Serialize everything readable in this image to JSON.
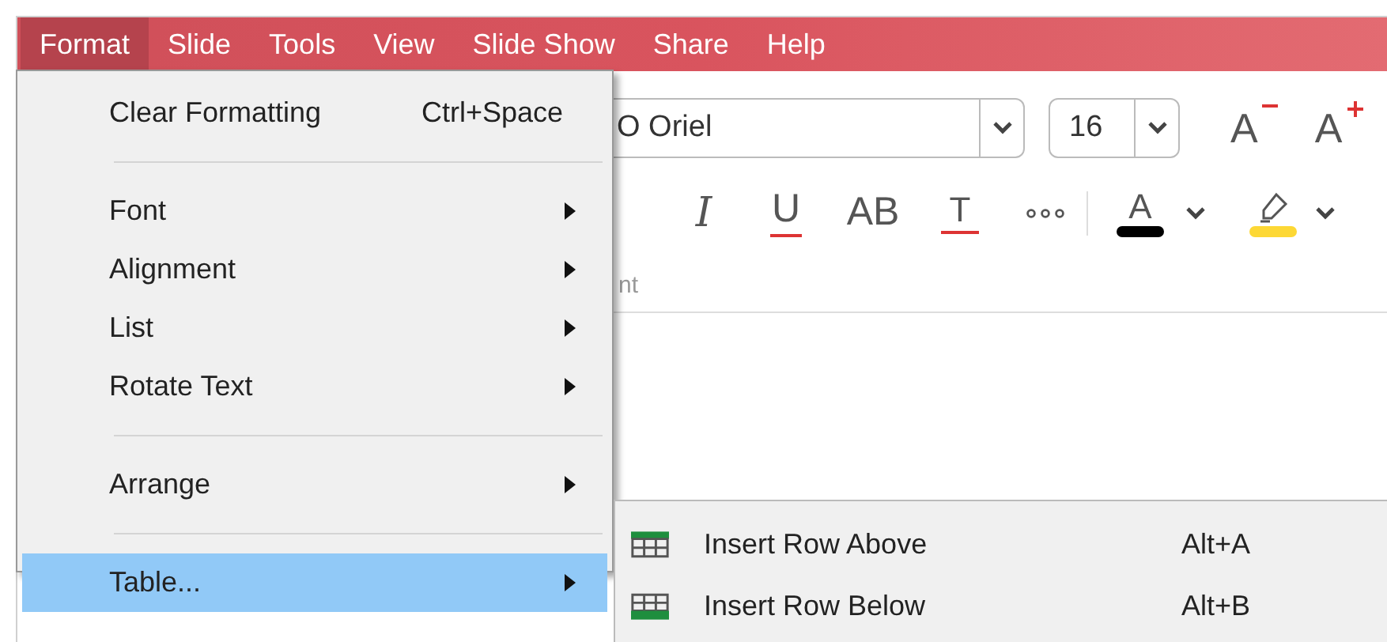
{
  "menubar": [
    {
      "label": "Format",
      "selected": true
    },
    {
      "label": "Slide",
      "selected": false
    },
    {
      "label": "Tools",
      "selected": false
    },
    {
      "label": "View",
      "selected": false
    },
    {
      "label": "Slide Show",
      "selected": false
    },
    {
      "label": "Share",
      "selected": false
    },
    {
      "label": "Help",
      "selected": false
    }
  ],
  "toolbar": {
    "font_field": {
      "value": "O Oriel"
    },
    "size_field": {
      "value": "16"
    },
    "size_buttons": [
      {
        "kind": "shrink",
        "glyph": "A"
      },
      {
        "kind": "grow",
        "glyph": "A"
      }
    ],
    "format_buttons": [
      {
        "kind": "italic",
        "glyph": "I"
      },
      {
        "kind": "underline",
        "glyph": "U"
      },
      {
        "kind": "caps",
        "glyph": "AB"
      },
      {
        "kind": "strike",
        "glyph": "T"
      },
      {
        "kind": "more"
      },
      {
        "kind": "divider"
      },
      {
        "kind": "font_color",
        "glyph": "A",
        "color": "#000000"
      },
      {
        "kind": "dropdown"
      },
      {
        "kind": "highlight",
        "color": "#fdd835"
      },
      {
        "kind": "dropdown"
      }
    ],
    "group_label": "nt"
  },
  "format_menu": [
    {
      "kind": "item",
      "label": "Clear Formatting",
      "shortcut": "Ctrl+Space",
      "selected": false
    },
    {
      "kind": "separator"
    },
    {
      "kind": "submenu",
      "label": "Font",
      "selected": false
    },
    {
      "kind": "submenu",
      "label": "Alignment",
      "selected": false
    },
    {
      "kind": "submenu",
      "label": "List",
      "selected": false
    },
    {
      "kind": "submenu",
      "label": "Rotate Text",
      "selected": false
    },
    {
      "kind": "separator"
    },
    {
      "kind": "submenu",
      "label": "Arrange",
      "selected": false
    },
    {
      "kind": "separator"
    },
    {
      "kind": "submenu",
      "label": "Table...",
      "selected": true
    }
  ],
  "table_submenu": [
    {
      "kind": "row_above",
      "label": "Insert Row Above",
      "shortcut": "Alt+A"
    },
    {
      "kind": "row_below",
      "label": "Insert Row Below",
      "shortcut": "Alt+B"
    }
  ]
}
